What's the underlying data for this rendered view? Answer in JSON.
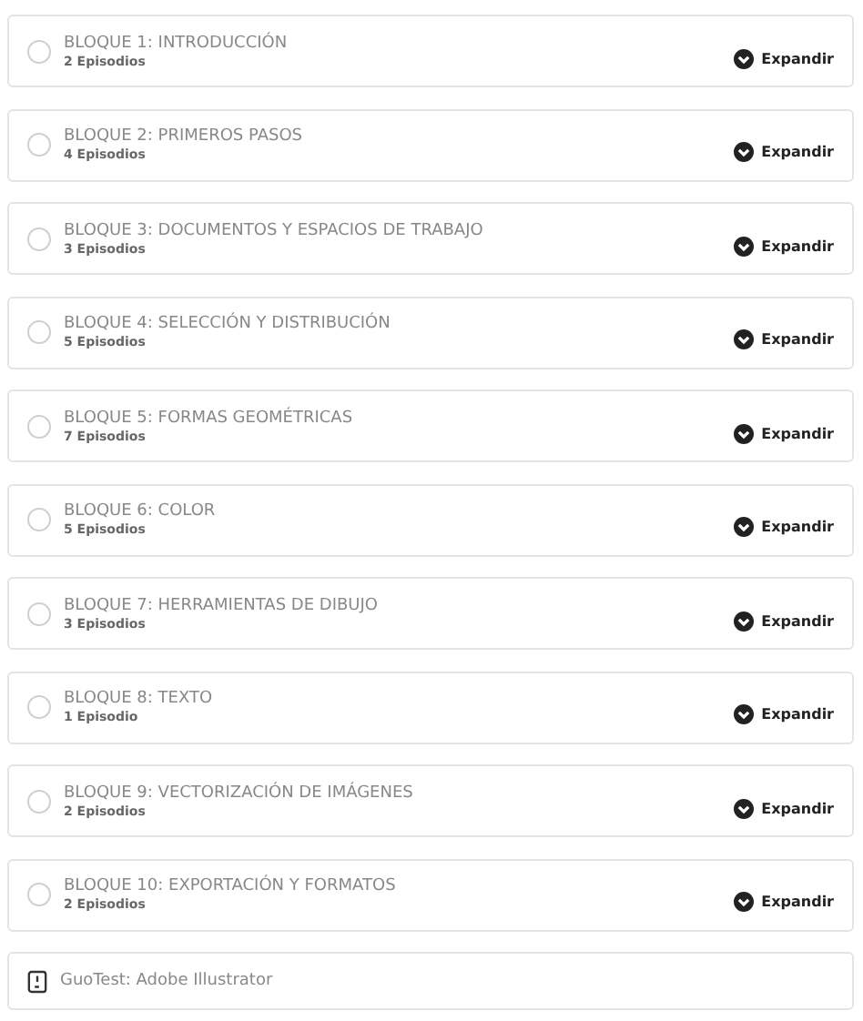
{
  "blocks": [
    {
      "title": "BLOQUE 1: INTRODUCCIÓN",
      "episodes": "2 Episodios",
      "completed": false,
      "action": "Expandir"
    },
    {
      "title": "BLOQUE 2: PRIMEROS PASOS",
      "episodes": "4 Episodios",
      "completed": false,
      "action": "Expandir"
    },
    {
      "title": "BLOQUE 3: DOCUMENTOS Y ESPACIOS DE TRABAJO",
      "episodes": "3 Episodios",
      "completed": false,
      "action": "Expandir"
    },
    {
      "title": "BLOQUE 4: SELECCIÓN Y DISTRIBUCIÓN",
      "episodes": "5 Episodios",
      "completed": false,
      "action": "Expandir"
    },
    {
      "title": "BLOQUE 5: FORMAS GEOMÉTRICAS",
      "episodes": "7 Episodios",
      "completed": false,
      "action": "Expandir"
    },
    {
      "title": "BLOQUE 6: COLOR",
      "episodes": "5 Episodios",
      "completed": false,
      "action": "Expandir"
    },
    {
      "title": "BLOQUE 7: HERRAMIENTAS DE DIBUJO",
      "episodes": "3 Episodios",
      "completed": false,
      "action": "Expandir"
    },
    {
      "title": "BLOQUE 8: TEXTO",
      "episodes": "1 Episodio",
      "completed": false,
      "action": "Expandir"
    },
    {
      "title": "BLOQUE 9: VECTORIZACIÓN DE IMÁGENES",
      "episodes": "2 Episodios",
      "completed": false,
      "action": "Expandir"
    },
    {
      "title": "BLOQUE 10: EXPORTACIÓN Y FORMATOS",
      "episodes": "2 Episodios",
      "completed": false,
      "action": "Expandir"
    }
  ],
  "test": {
    "title": "GuoTest: Adobe Illustrator"
  }
}
